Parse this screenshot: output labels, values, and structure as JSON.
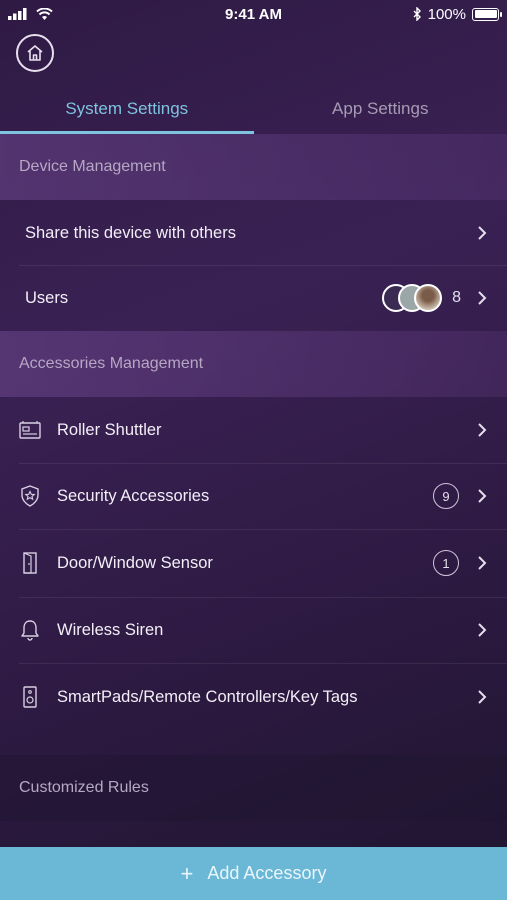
{
  "status_bar": {
    "time": "9:41 AM",
    "battery": "100%"
  },
  "tabs": [
    {
      "label": "System Settings",
      "active": true
    },
    {
      "label": "App Settings",
      "active": false
    }
  ],
  "device_management": {
    "header": "Device Management",
    "items": [
      {
        "label": "Share this device with others"
      },
      {
        "label": "Users",
        "count": "8"
      }
    ]
  },
  "accessories_management": {
    "header": "Accessories Management",
    "items": [
      {
        "label": "Roller Shuttler",
        "icon": "roller-shutter-icon"
      },
      {
        "label": "Security Accessories",
        "icon": "shield-star-icon",
        "badge": "9"
      },
      {
        "label": "Door/Window Sensor",
        "icon": "door-icon",
        "badge": "1"
      },
      {
        "label": "Wireless Siren",
        "icon": "bell-icon"
      },
      {
        "label": "SmartPads/Remote Controllers/Key Tags",
        "icon": "remote-icon"
      }
    ]
  },
  "customized_rules": {
    "header": "Customized Rules"
  },
  "add_button": {
    "label": "Add Accessory"
  },
  "colors": {
    "accent": "#7ec3e0",
    "add_bar": "#6ab7d6",
    "background": "#34204b"
  }
}
